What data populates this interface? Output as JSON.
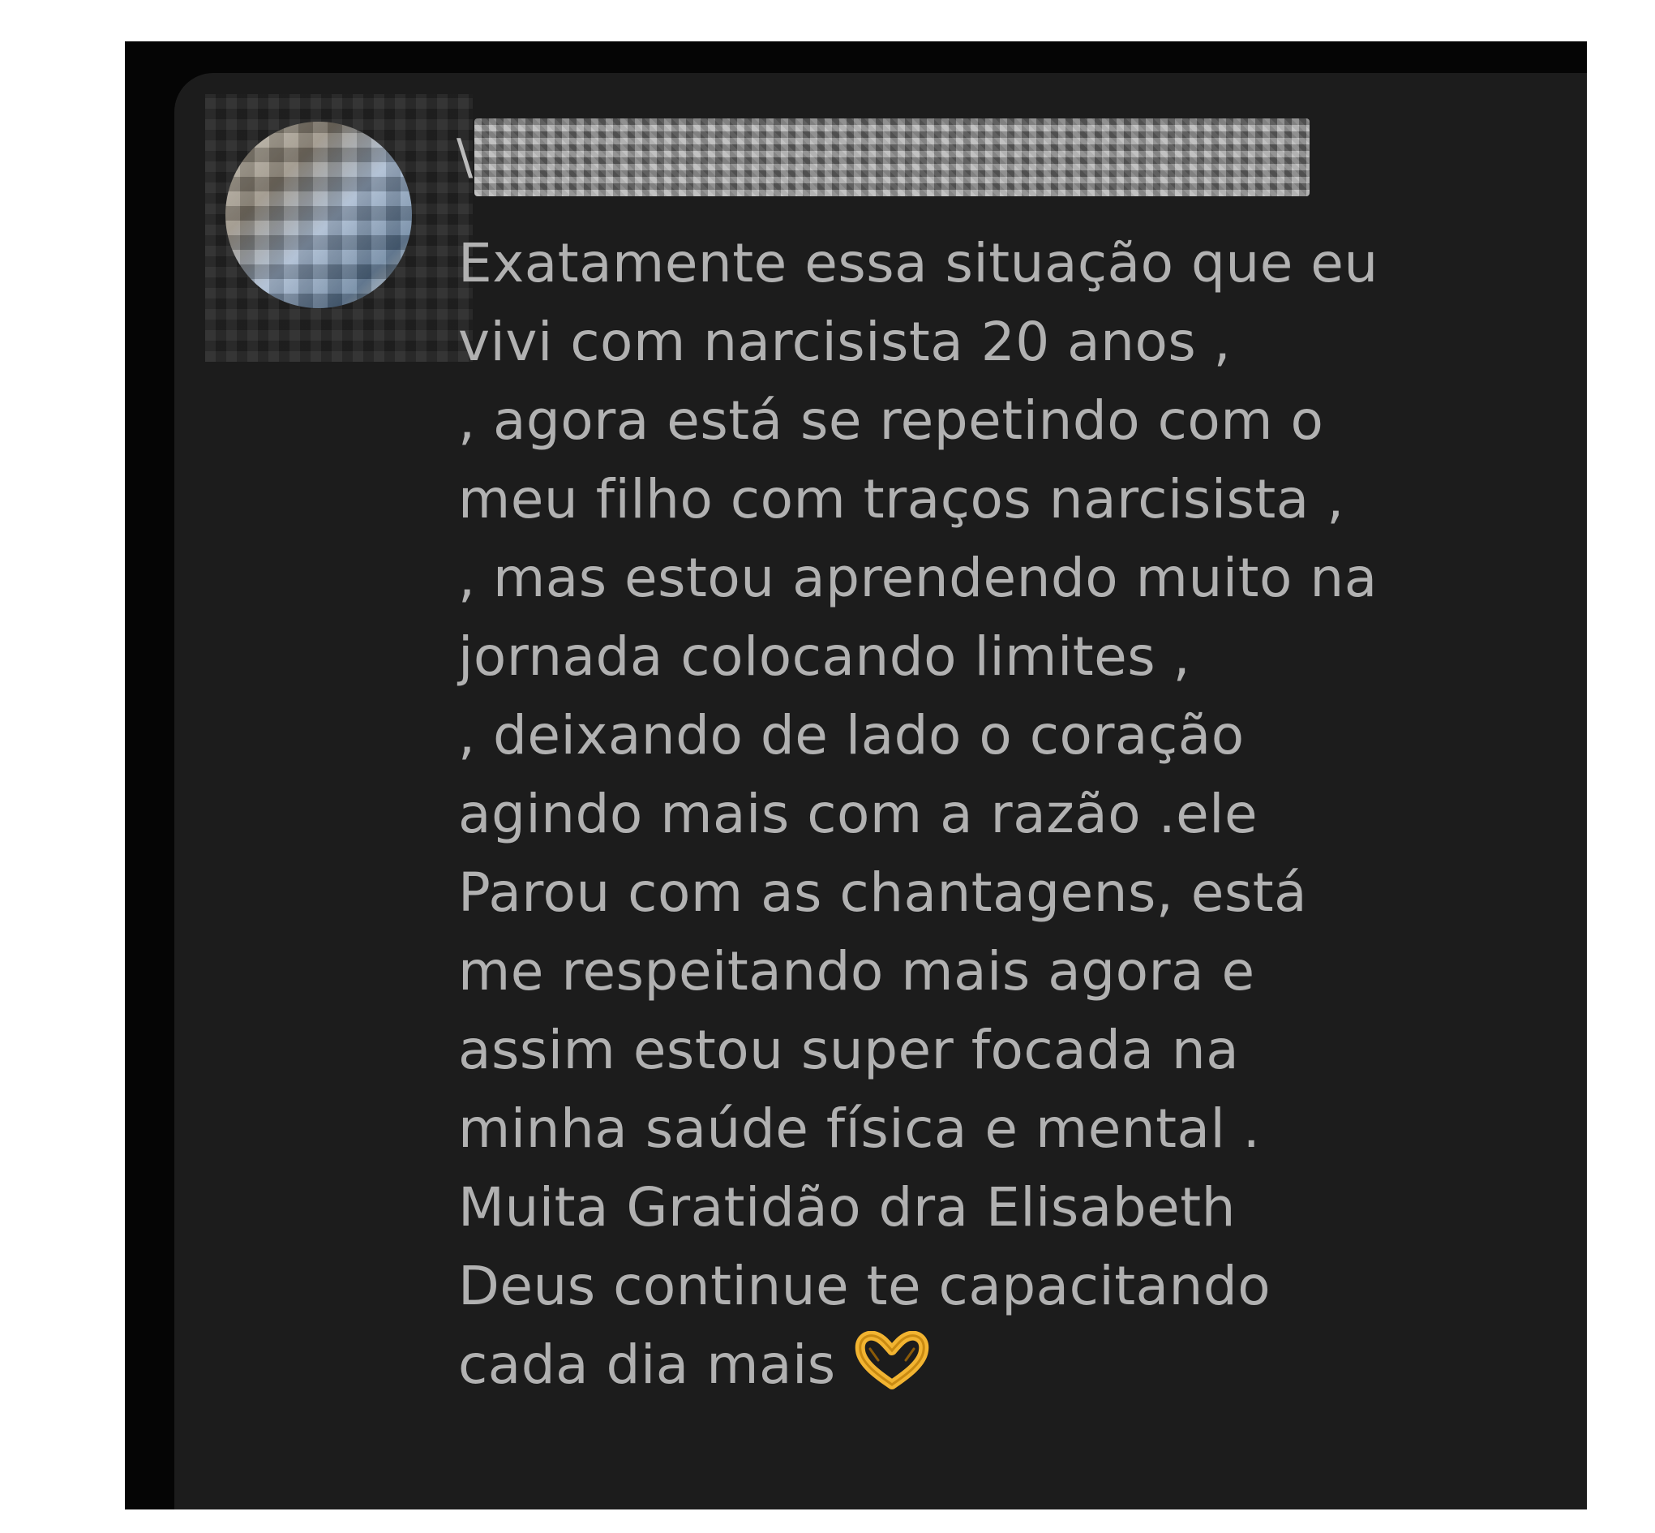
{
  "comment": {
    "author_visible_initial": "\\",
    "author_name_redacted": true,
    "avatar_redacted": true,
    "lines": [
      "Exatamente essa situação que eu",
      "vivi com narcisista 20 anos ,",
      ", agora está se repetindo com o",
      "meu filho com traços narcisista ,",
      ", mas estou aprendendo muito na",
      "jornada colocando limites ,",
      ", deixando de lado o coração",
      "agindo mais com a razão .ele",
      "Parou com as chantagens, está",
      "me respeitando mais agora e",
      "assim estou super focada na",
      "minha saúde física e mental .",
      "Muita Gratidão dra Elisabeth",
      "Deus continue te capacitando",
      "cada dia mais"
    ],
    "trailing_emoji": "heart-hands-emoji"
  },
  "colors": {
    "background_frame": "#050505",
    "card_background": "#1c1c1c",
    "text": "#b1b1b1",
    "emoji": "#f2b431"
  }
}
